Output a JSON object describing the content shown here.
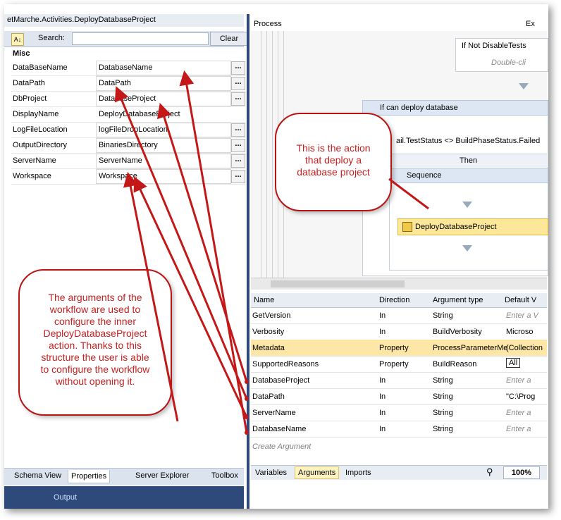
{
  "left_panel": {
    "title": "etMarche.Activities.DeployDatabaseProject",
    "search_label": "Search:",
    "clear_label": "Clear",
    "section": "Misc",
    "properties": [
      {
        "name": "DataBaseName",
        "value": "DatabaseName"
      },
      {
        "name": "DataPath",
        "value": "DataPath"
      },
      {
        "name": "DbProject",
        "value": "DatabaseProject"
      },
      {
        "name": "DisplayName",
        "value": "DeployDatabaseProject"
      },
      {
        "name": "LogFileLocation",
        "value": "logFileDropLocation"
      },
      {
        "name": "OutputDirectory",
        "value": "BinariesDirectory"
      },
      {
        "name": "ServerName",
        "value": "ServerName"
      },
      {
        "name": "Workspace",
        "value": "Workspace"
      }
    ],
    "dots": "...",
    "tabs": [
      "Schema View",
      "Properties",
      "Server Explorer",
      "Toolbox"
    ],
    "bottom_tab": "Output"
  },
  "designer": {
    "title": "Process",
    "title_right": "Ex",
    "if_not": "If Not DisableTests",
    "double_click": "Double-cli",
    "if_can": "If can deploy database",
    "condition_1": "ail.TestStatus <> BuildPhaseStatus.Failed",
    "then": "Then",
    "sequence": "Sequence",
    "deploy": "DeployDatabaseProject"
  },
  "arguments": {
    "headers": [
      "Name",
      "Direction",
      "Argument type",
      "Default V"
    ],
    "rows": [
      {
        "name": "GetVersion",
        "direction": "In",
        "type": "String",
        "default": "Enter a V"
      },
      {
        "name": "Verbosity",
        "direction": "In",
        "type": "BuildVerbosity",
        "default": "Microso"
      },
      {
        "name": "Metadata",
        "direction": "Property",
        "type": "ProcessParameterMe",
        "default": "(Collection"
      },
      {
        "name": "SupportedReasons",
        "direction": "Property",
        "type": "BuildReason",
        "default": "All"
      },
      {
        "name": "DatabaseProject",
        "direction": "In",
        "type": "String",
        "default": "Enter a"
      },
      {
        "name": "DataPath",
        "direction": "In",
        "type": "String",
        "default": "\"C:\\Prog"
      },
      {
        "name": "ServerName",
        "direction": "In",
        "type": "String",
        "default": "Enter a"
      },
      {
        "name": "DatabaseName",
        "direction": "In",
        "type": "String",
        "default": "Enter a"
      }
    ],
    "create": "Create Argument",
    "bottom_tabs": [
      "Variables",
      "Arguments",
      "Imports"
    ],
    "zoom": "100%"
  },
  "callouts": {
    "top": [
      "This is the action",
      "that deploy a",
      "database project"
    ],
    "left": [
      "The arguments of the",
      "workflow are used to",
      "configure the inner",
      "DeployDatabaseProject",
      "action. Thanks to this",
      "structure the user is able",
      "to configure the workflow",
      "without opening it."
    ]
  },
  "colors": {
    "callout_border": "#b81414",
    "callout_text": "#c62020",
    "highlight": "#fde6a6"
  }
}
